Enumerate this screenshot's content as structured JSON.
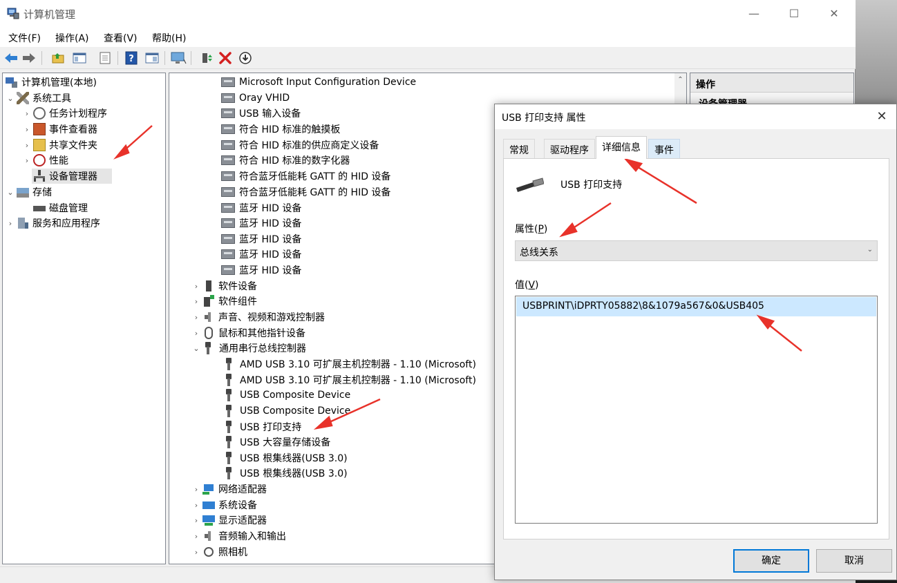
{
  "window": {
    "title": "计算机管理",
    "minimize": "—",
    "maximize": "☐",
    "close": "✕"
  },
  "menu": [
    "文件(F)",
    "操作(A)",
    "查看(V)",
    "帮助(H)"
  ],
  "toolbar": [
    "back-arrow-icon",
    "forward-arrow-icon",
    "up-folder-icon",
    "show-hide-tree-icon",
    "export-list-icon",
    "help-icon",
    "show-pane-icon",
    "computer-icon",
    "enable-device-icon",
    "uninstall-x-icon",
    "update-driver-icon"
  ],
  "tree": {
    "root": "计算机管理(本地)",
    "system_tools": "系统工具",
    "task_scheduler": "任务计划程序",
    "event_viewer": "事件查看器",
    "shared_folders": "共享文件夹",
    "performance": "性能",
    "device_manager": "设备管理器",
    "storage": "存储",
    "disk_management": "磁盘管理",
    "services_apps": "服务和应用程序"
  },
  "devices": {
    "hid_items": [
      "Microsoft Input Configuration Device",
      "Oray VHID",
      "USB 输入设备",
      "符合 HID 标准的触摸板",
      "符合 HID 标准的供应商定义设备",
      "符合 HID 标准的数字化器",
      "符合蓝牙低能耗 GATT 的 HID 设备",
      "符合蓝牙低能耗 GATT 的 HID 设备",
      "蓝牙 HID 设备",
      "蓝牙 HID 设备",
      "蓝牙 HID 设备",
      "蓝牙 HID 设备",
      "蓝牙 HID 设备"
    ],
    "cat_software_devices": "软件设备",
    "cat_software_components": "软件组件",
    "cat_sound": "声音、视频和游戏控制器",
    "cat_mice": "鼠标和其他指针设备",
    "cat_usb": "通用串行总线控制器",
    "usb_items": [
      "AMD USB 3.10 可扩展主机控制器 - 1.10 (Microsoft)",
      "AMD USB 3.10 可扩展主机控制器 - 1.10 (Microsoft)",
      "USB Composite Device",
      "USB Composite Device",
      "USB 打印支持",
      "USB 大容量存储设备",
      "USB 根集线器(USB 3.0)",
      "USB 根集线器(USB 3.0)"
    ],
    "cat_network": "网络适配器",
    "cat_system": "系统设备",
    "cat_display": "显示适配器",
    "cat_audio_io": "音频输入和输出",
    "cat_camera": "照相机"
  },
  "actions": {
    "header": "操作",
    "item": "设备管理器"
  },
  "dialog": {
    "title": "USB 打印支持 属性",
    "close": "✕",
    "tabs": [
      "常规",
      "驱动程序",
      "详细信息",
      "事件"
    ],
    "device_name": "USB 打印支持",
    "property_label": "属性(P)",
    "property_value": "总线关系",
    "value_label": "值(V)",
    "value_text": "USBPRINT\\iDPRTY05882\\8&1079a567&0&USB405",
    "ok": "确定",
    "cancel": "取消"
  },
  "colors": {
    "selection": "#cce8ff",
    "accent": "#0078d7",
    "annotation_arrow": "#e8322a"
  }
}
